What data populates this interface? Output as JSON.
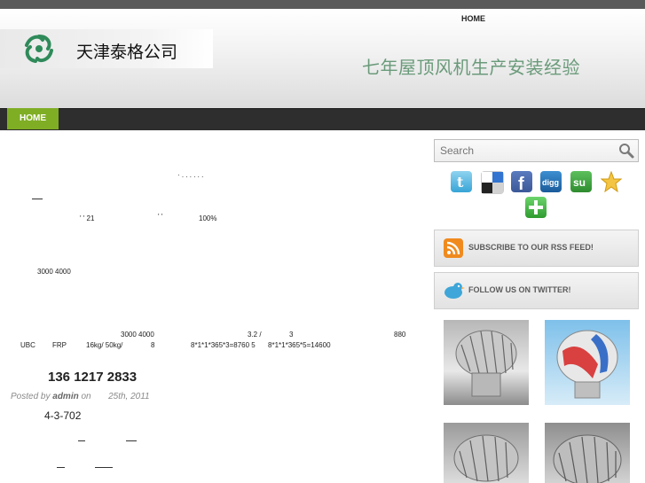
{
  "header": {
    "top_nav_home": "HOME",
    "logo_text": "天津泰格公司",
    "tagline": "七年屋顶风机生产安装经验"
  },
  "nav": {
    "home": "HOME"
  },
  "content": {
    "frag_line1": "·  .          .    .              .     .     .",
    "frag_line2": "' ' 21",
    "frag_line2b": "' '",
    "frag_line2c": "100%",
    "frag_line3": "3000 4000",
    "frag_line4": "3000 4000",
    "frag_line4b": "3.2  /",
    "frag_line4c": "3",
    "frag_line4d": "880",
    "frag_line5a": "UBC",
    "frag_line5b": "FRP",
    "frag_line5c": "16kg/ 50kg/",
    "frag_line5d": "8",
    "frag_line5e": "8*1*1*365*3=8760 5",
    "frag_line5f": "8*1*1*365*5=14600",
    "phone": "136 1217 2833",
    "meta_posted": "Posted by",
    "meta_author": "admin",
    "meta_on": "on",
    "meta_date": "25th, 2011",
    "address": "4-3-702"
  },
  "sidebar": {
    "search_placeholder": "Search",
    "social_icons": [
      "twitter-icon",
      "delicious-icon",
      "facebook-icon",
      "digg-icon",
      "stumbleupon-icon",
      "favorite-star-icon",
      "add-plus-icon"
    ],
    "rss_label": "SUBSCRIBE TO OUR RSS FEED!",
    "twitter_label": "FOLLOW US ON TWITTER!"
  },
  "colors": {
    "nav_active": "#7fae25",
    "nav_bar": "#2e2e2e",
    "tagline": "#6a9a7a",
    "rss_orange": "#f08a1e",
    "twitter_blue": "#3ea6d8"
  }
}
